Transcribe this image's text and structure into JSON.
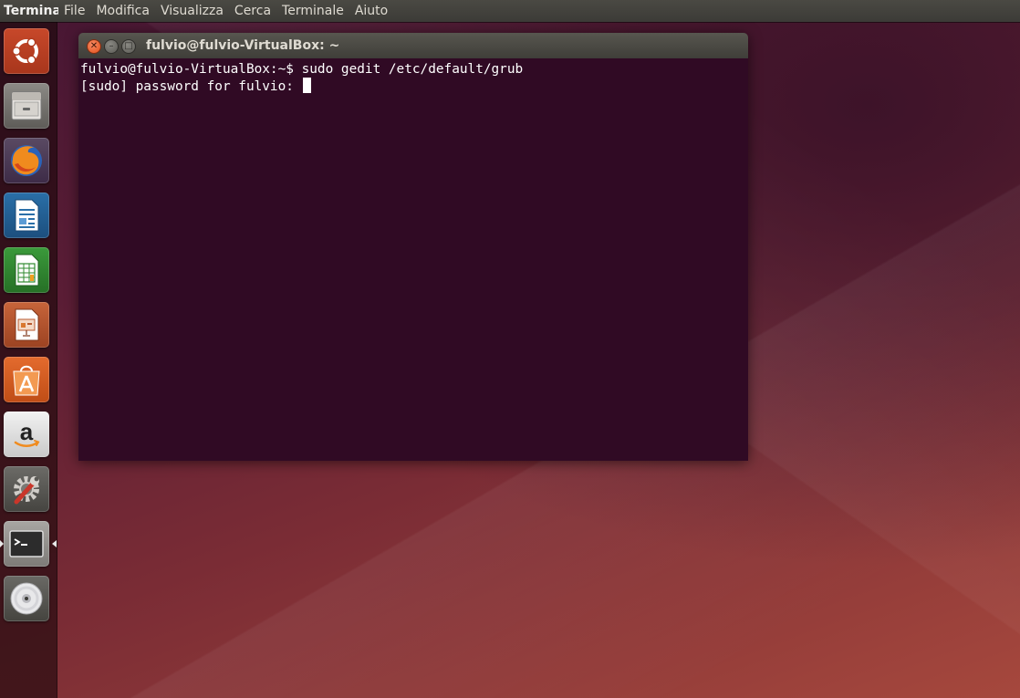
{
  "top_panel": {
    "app_title": "Terminale",
    "menu": [
      "File",
      "Modifica",
      "Visualizza",
      "Cerca",
      "Terminale",
      "Aiuto"
    ]
  },
  "launcher": {
    "items": [
      {
        "name": "ubuntu-dash",
        "icon": "ubuntu-logo-icon"
      },
      {
        "name": "files",
        "icon": "file-cabinet-icon"
      },
      {
        "name": "firefox",
        "icon": "firefox-icon"
      },
      {
        "name": "libreoffice-writer",
        "icon": "writer-document-icon"
      },
      {
        "name": "libreoffice-calc",
        "icon": "calc-spreadsheet-icon"
      },
      {
        "name": "libreoffice-impress",
        "icon": "impress-presentation-icon"
      },
      {
        "name": "software-center",
        "icon": "shopping-bag-icon"
      },
      {
        "name": "amazon",
        "icon": "amazon-icon"
      },
      {
        "name": "system-settings",
        "icon": "wrench-gear-icon"
      },
      {
        "name": "terminal",
        "icon": "terminal-icon"
      },
      {
        "name": "dvd",
        "icon": "disc-icon"
      }
    ]
  },
  "window": {
    "title": "fulvio@fulvio-VirtualBox: ~",
    "close_glyph": "✕",
    "minimize_glyph": "–",
    "maximize_glyph": "□",
    "lines": [
      "fulvio@fulvio-VirtualBox:~$ sudo gedit /etc/default/grub",
      "[sudo] password for fulvio: "
    ]
  },
  "colors": {
    "terminal_bg": "#300a24",
    "panel_bg": "#3c3b37",
    "close_button": "#e2501a"
  }
}
